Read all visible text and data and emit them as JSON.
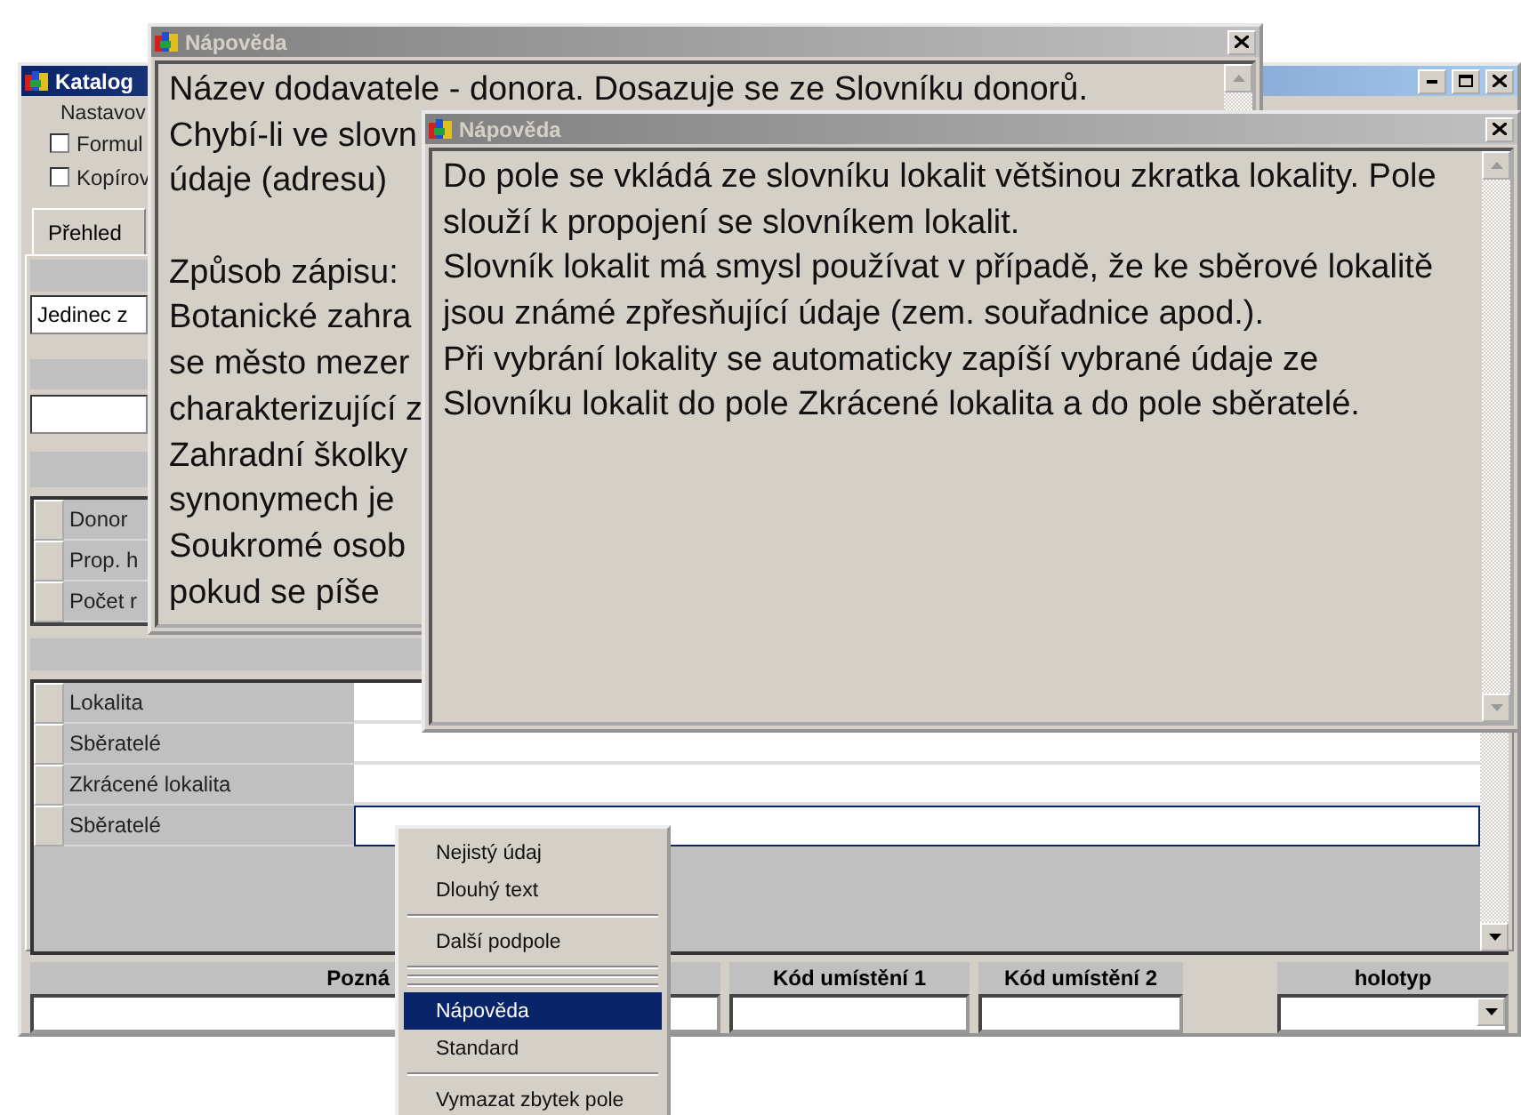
{
  "main_window": {
    "title": "Katalog",
    "subtitle": "Nastavov",
    "checkboxes": [
      {
        "label": "Formul",
        "checked": false
      },
      {
        "label": "Kopírov",
        "checked": false
      }
    ],
    "tabs": [
      {
        "label": "Přehled",
        "selected": true
      }
    ],
    "record_field": {
      "value": "Jedinec z"
    },
    "summary_rows": [
      {
        "label": "Donor"
      },
      {
        "label": "Prop. h"
      },
      {
        "label": "Počet r"
      }
    ],
    "grid_rows": [
      {
        "label": "Lokalita",
        "selected": false
      },
      {
        "label": "Sběratelé",
        "selected": false
      },
      {
        "label": "Zkrácené lokalita",
        "selected": false
      },
      {
        "label": "Sběratelé",
        "selected": true
      }
    ],
    "bottom_fields": [
      {
        "label": "Pozná",
        "kind": "text"
      },
      {
        "label": "Kód umístění 1",
        "kind": "text"
      },
      {
        "label": "Kód umístění 2",
        "kind": "text"
      },
      {
        "label": "holotyp",
        "kind": "dropdown"
      }
    ]
  },
  "help_windows": [
    {
      "title": "Nápověda",
      "paragraphs": [
        [
          "Název dodavatele - donora. Dosazuje se ze Slovníku donorů.",
          "Chybí-li ve slovn",
          "údaje (adresu)"
        ],
        [
          "Způsob zápisu:",
          "Botanické zahra",
          "se město mezer",
          "charakterizující z",
          "Zahradní školky",
          "synonymech je",
          "Soukromé osob",
          "pokud se píše"
        ]
      ]
    },
    {
      "title": "Nápověda",
      "paragraphs": [
        [
          "Do pole se vkládá ze slovníku lokalit většinou zkratka lokality. Pole",
          "slouží k propojení se slovníkem lokalit.",
          "Slovník lokalit má smysl používat v případě, že ke sběrové lokalitě",
          "jsou známé zpřesňující údaje (zem. souřadnice apod.).",
          "Při vybrání lokality se automaticky zapíší vybrané údaje ze",
          "Slovníku lokalit do pole Zkrácené lokalita a do pole sběratelé."
        ]
      ]
    }
  ],
  "context_menu": [
    {
      "kind": "item",
      "label": "Nejistý údaj",
      "selected": false
    },
    {
      "kind": "item",
      "label": "Dlouhý text",
      "selected": false
    },
    {
      "kind": "separator"
    },
    {
      "kind": "item",
      "label": "Další podpole",
      "selected": false
    },
    {
      "kind": "separator"
    },
    {
      "kind": "separator"
    },
    {
      "kind": "separator"
    },
    {
      "kind": "item",
      "label": "Nápověda",
      "selected": true
    },
    {
      "kind": "item",
      "label": "Standard",
      "selected": false
    },
    {
      "kind": "separator"
    },
    {
      "kind": "item",
      "label": "Vymazat zbytek pole",
      "selected": false
    }
  ]
}
